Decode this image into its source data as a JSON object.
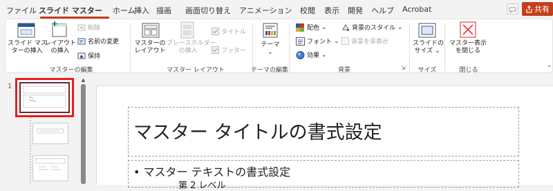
{
  "tabs": [
    {
      "label": "ファイル"
    },
    {
      "label": "スライド マスター",
      "active": true
    },
    {
      "label": "ホーム"
    },
    {
      "label": "挿入"
    },
    {
      "label": "描画"
    },
    {
      "label": "画面切り替え"
    },
    {
      "label": "アニメーション"
    },
    {
      "label": "校閲"
    },
    {
      "label": "表示"
    },
    {
      "label": "開発"
    },
    {
      "label": "ヘルプ"
    },
    {
      "label": "Acrobat"
    }
  ],
  "share": {
    "label": "共有",
    "icon": "share-icon"
  },
  "accent": "#c43e1c",
  "ribbon": {
    "master_edit": {
      "insert_slide_master": [
        "スライド マス",
        "ターの挿入"
      ],
      "insert_layout": [
        "レイアウト",
        "の挿入"
      ],
      "delete": "削除",
      "rename": "名前の変更",
      "preserve": "保持",
      "group_label": "マスターの編集"
    },
    "master_layout": {
      "master_layout": [
        "マスターの",
        "レイアウト"
      ],
      "insert_placeholder": [
        "プレースホルダー",
        "の挿入"
      ],
      "title": "タイトル",
      "footer": "フッター",
      "group_label": "マスター レイアウト"
    },
    "theme_edit": {
      "theme": "テーマ",
      "group_label": "テーマの編集"
    },
    "background": {
      "colors": "配色",
      "fonts": "フォント",
      "effects": "効果",
      "background_styles": "背景のスタイル",
      "hide_background": "背景を非表示",
      "group_label": "背景"
    },
    "size": {
      "slide_size": [
        "スライドの",
        "サイズ"
      ],
      "group_label": "サイズ"
    },
    "close": {
      "close_master": [
        "マスター表示",
        "を閉じる"
      ],
      "group_label": "閉じる"
    }
  },
  "thumbnails": {
    "selected_number": "1"
  },
  "slide": {
    "title": "マスター タイトルの書式設定",
    "body_level1": "• マスター テキストの書式設定",
    "body_level2": "第 2 レベル"
  }
}
